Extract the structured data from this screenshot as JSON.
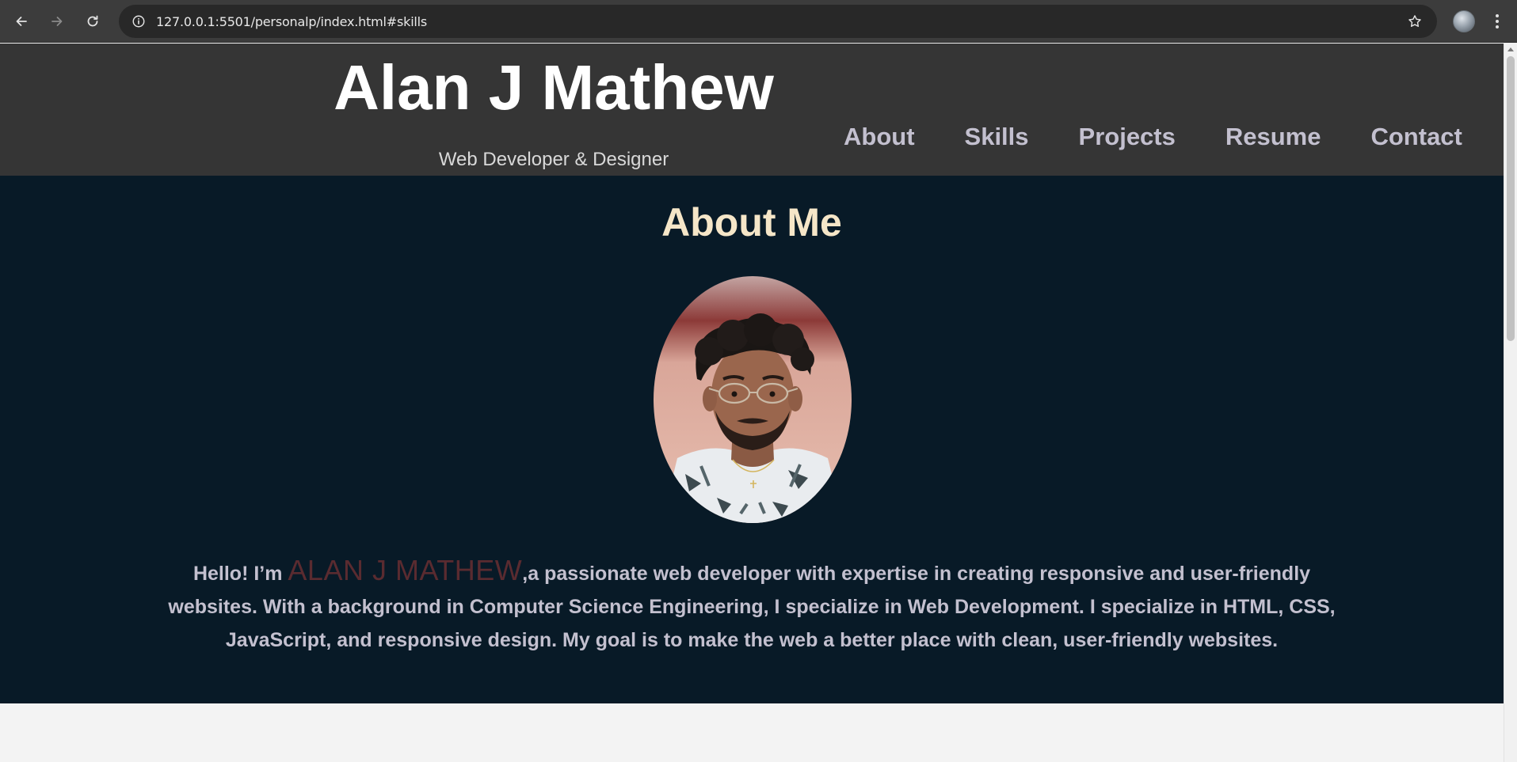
{
  "browser": {
    "url": "127.0.0.1:5501/personalp/index.html#skills",
    "icons": [
      "back-icon",
      "forward-icon",
      "reload-icon",
      "site-info-icon",
      "bookmark-star-icon",
      "profile-avatar",
      "more-menu-icon"
    ]
  },
  "header": {
    "name": "Alan J Mathew",
    "tagline": "Web Developer & Designer",
    "nav": [
      {
        "label": "About"
      },
      {
        "label": "Skills"
      },
      {
        "label": "Projects"
      },
      {
        "label": "Resume"
      },
      {
        "label": "Contact"
      }
    ]
  },
  "about": {
    "title": "About Me",
    "intro_prefix": "Hello! I’m ",
    "highlight_name": "ALAN J MATHEW",
    "intro_body": ",a passionate web developer with expertise in creating responsive and user-friendly websites. With a background in Computer Science Engineering, I specialize in Web Development. I specialize in HTML, CSS, JavaScript, and responsive design. My goal is to make the web a better place with clean, user-friendly websites."
  },
  "colors": {
    "header_bg": "#353535",
    "about_bg": "#081a27",
    "title_color": "#f5e6c8",
    "nav_color": "#c3c0cf",
    "highlight_color": "#5a2b30"
  }
}
